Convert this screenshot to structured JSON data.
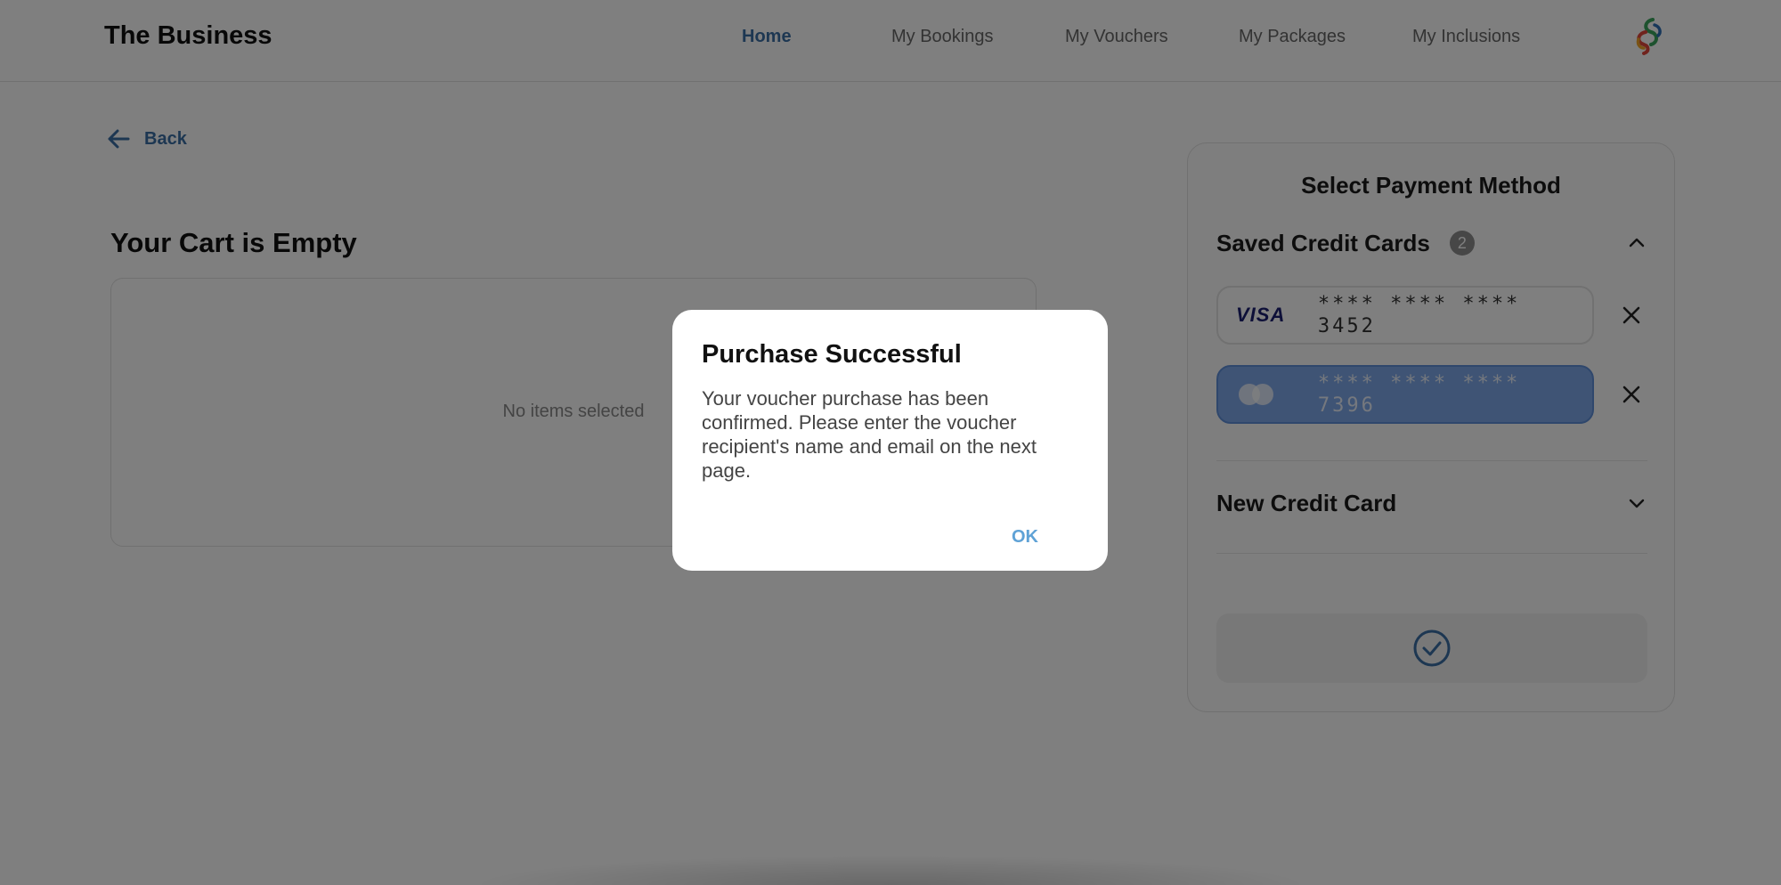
{
  "header": {
    "brand": "The Business",
    "nav": [
      {
        "label": "Home",
        "active": true
      },
      {
        "label": "My Bookings",
        "active": false
      },
      {
        "label": "My Vouchers",
        "active": false
      },
      {
        "label": "My Packages",
        "active": false
      },
      {
        "label": "My Inclusions",
        "active": false
      }
    ]
  },
  "back_label": "Back",
  "cart": {
    "title": "Your Cart is Empty",
    "empty_text": "No items selected"
  },
  "payment": {
    "title": "Select Payment Method",
    "saved_label": "Saved Credit Cards",
    "saved_count": "2",
    "cards": [
      {
        "brand": "visa",
        "brand_text": "VISA",
        "number": "**** **** **** 3452",
        "selected": false
      },
      {
        "brand": "mastercard",
        "number": "**** **** **** 7396",
        "selected": true
      }
    ],
    "new_label": "New Credit Card"
  },
  "dialog": {
    "title": "Purchase Successful",
    "message": "Your voucher purchase has been confirmed. Please enter the voucher recipient's name and email on the next page.",
    "ok_label": "OK"
  },
  "colors": {
    "accent": "#3b6ea5",
    "selected_card": "#7fa9ea",
    "ok_button": "#5fa2d6"
  }
}
